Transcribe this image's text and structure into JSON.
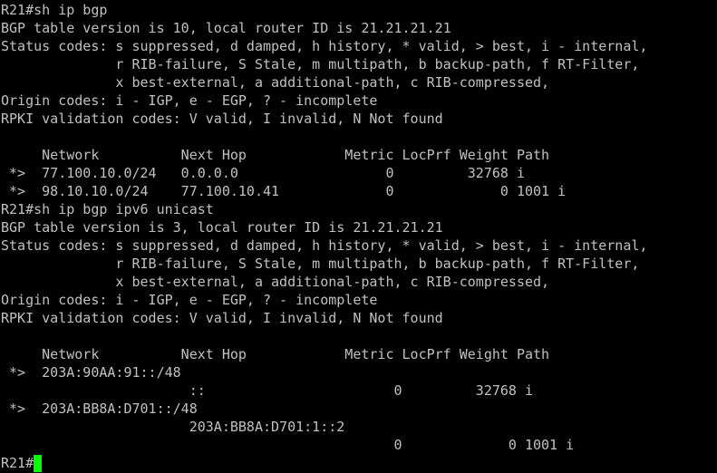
{
  "terminal": {
    "colors": {
      "background": "#000000",
      "text": "#c0c0c0",
      "cursor": "#00ff00"
    },
    "lines": [
      "R21#sh ip bgp",
      "BGP table version is 10, local router ID is 21.21.21.21",
      "Status codes: s suppressed, d damped, h history, * valid, > best, i - internal,",
      "              r RIB-failure, S Stale, m multipath, b backup-path, f RT-Filter,",
      "              x best-external, a additional-path, c RIB-compressed,",
      "Origin codes: i - IGP, e - EGP, ? - incomplete",
      "RPKI validation codes: V valid, I invalid, N Not found",
      "",
      "     Network          Next Hop            Metric LocPrf Weight Path",
      " *>  77.100.10.0/24   0.0.0.0                  0         32768 i",
      " *>  98.10.10.0/24    77.100.10.41             0             0 1001 i",
      "R21#sh ip bgp ipv6 unicast",
      "BGP table version is 3, local router ID is 21.21.21.21",
      "Status codes: s suppressed, d damped, h history, * valid, > best, i - internal,",
      "              r RIB-failure, S Stale, m multipath, b backup-path, f RT-Filter,",
      "              x best-external, a additional-path, c RIB-compressed,",
      "Origin codes: i - IGP, e - EGP, ? - incomplete",
      "RPKI validation codes: V valid, I invalid, N Not found",
      "",
      "     Network          Next Hop            Metric LocPrf Weight Path",
      " *>  203A:90AA:91::/48",
      "                       ::                       0         32768 i",
      " *>  203A:BB8A:D701::/48",
      "                       203A:BB8A:D701:1::2",
      "                                                0             0 1001 i"
    ],
    "prompt": "R21#"
  }
}
